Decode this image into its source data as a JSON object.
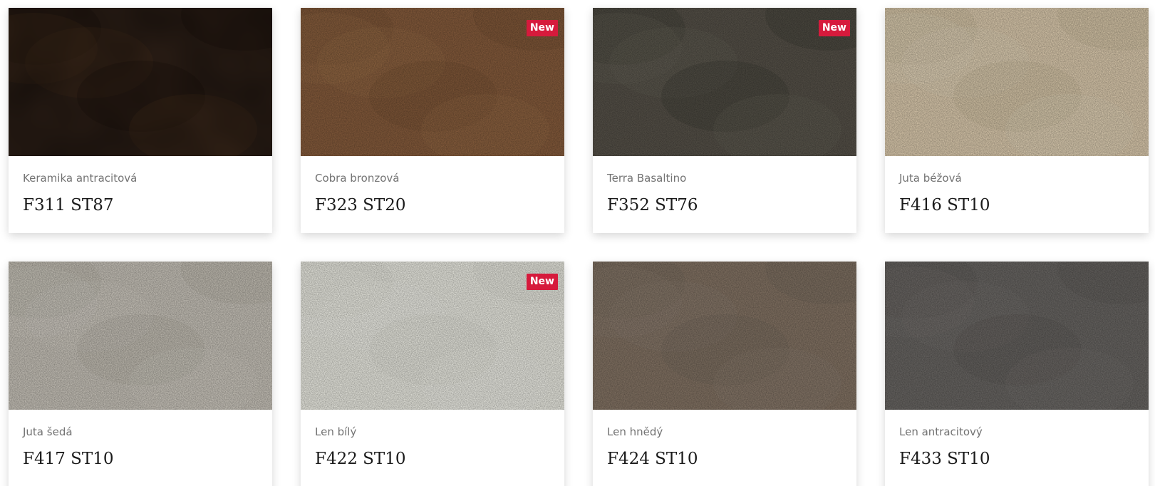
{
  "badge_label": "New",
  "products": [
    {
      "name": "Keramika antracitová",
      "code": "F311 ST87",
      "is_new": false,
      "colors": {
        "base": "#2a1d15",
        "alt": "#49301d",
        "grain": "#130d09"
      }
    },
    {
      "name": "Cobra bronzová",
      "code": "F323 ST20",
      "is_new": true,
      "colors": {
        "base": "#8b5f3e",
        "alt": "#a0724c",
        "grain": "#6e4a30"
      }
    },
    {
      "name": "Terra Basaltino",
      "code": "F352 ST76",
      "is_new": true,
      "colors": {
        "base": "#59544b",
        "alt": "#6b665c",
        "grain": "#35322d"
      }
    },
    {
      "name": "Juta béžová",
      "code": "F416 ST10",
      "is_new": false,
      "colors": {
        "base": "#e5d3b5",
        "alt": "#eddfc6",
        "grain": "#c9b797"
      }
    },
    {
      "name": "Juta šedá",
      "code": "F417 ST10",
      "is_new": false,
      "colors": {
        "base": "#d0cbc1",
        "alt": "#ddd9cf",
        "grain": "#b5b0a5"
      }
    },
    {
      "name": "Len bílý",
      "code": "F422 ST10",
      "is_new": true,
      "colors": {
        "base": "#f5f5ec",
        "alt": "#fbfbf5",
        "grain": "#e4e4d8"
      }
    },
    {
      "name": "Len hnědý",
      "code": "F424 ST10",
      "is_new": false,
      "colors": {
        "base": "#897868",
        "alt": "#958576",
        "grain": "#74665a"
      }
    },
    {
      "name": "Len antracitový",
      "code": "F433 ST10",
      "is_new": false,
      "colors": {
        "base": "#6d6a67",
        "alt": "#7a7774",
        "grain": "#5a5855"
      }
    }
  ]
}
